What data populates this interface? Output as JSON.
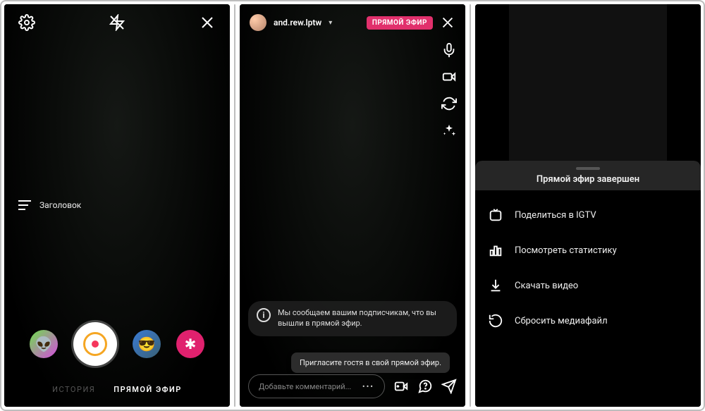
{
  "screen1": {
    "title_label": "Заголовок",
    "filters": [
      {
        "name": "filter-alien",
        "emoji": "👽"
      },
      {
        "name": "filter-live-shutter",
        "emoji": ""
      },
      {
        "name": "filter-sunglasses",
        "emoji": "😎"
      },
      {
        "name": "filter-sparkle",
        "emoji": "✱"
      }
    ],
    "modes": {
      "inactive": "ИСТОРИЯ",
      "active": "ПРЯМОЙ ЭФИР"
    }
  },
  "screen2": {
    "username": "and.rew.lptw",
    "live_badge": "ПРЯМОЙ ЭФИР",
    "notice": "Мы сообщаем вашим подписчикам, что вы вышли в прямой эфир.",
    "invite_tooltip": "Пригласите гостя в свой прямой эфир.",
    "comment_placeholder": "Добавьте комментарий..."
  },
  "screen3": {
    "sheet_title": "Прямой эфир завершен",
    "items": [
      {
        "key": "igtv",
        "label": "Поделиться в IGTV"
      },
      {
        "key": "stats",
        "label": "Посмотреть статистику"
      },
      {
        "key": "download",
        "label": "Скачать видео"
      },
      {
        "key": "discard",
        "label": "Сбросить медиафайл"
      }
    ]
  }
}
